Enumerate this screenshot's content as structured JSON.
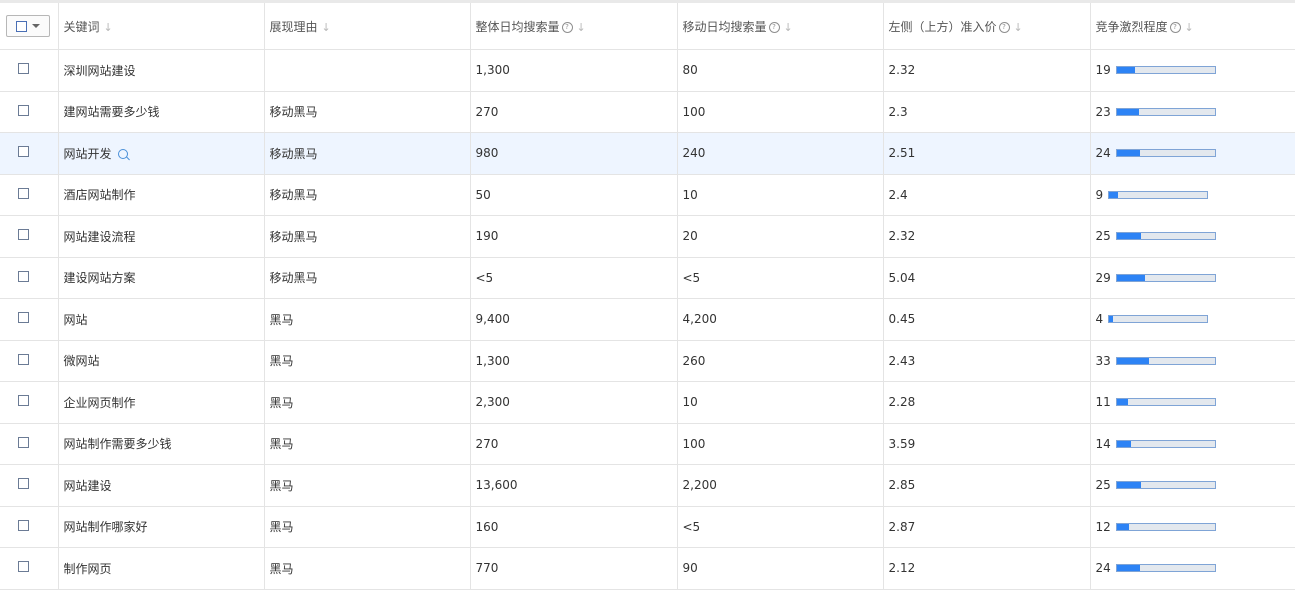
{
  "header": {
    "keyword": "关键词",
    "reason": "展现理由",
    "daily_search": "整体日均搜索量",
    "mobile_search": "移动日均搜索量",
    "left_top_price": "左侧（上方）准入价",
    "competition": "竞争激烈程度",
    "help_glyph": "?",
    "sort_glyph": "↓"
  },
  "rows": [
    {
      "keyword": "深圳网站建设",
      "reason": "",
      "daily": "1,300",
      "mobile": "80",
      "price": "2.32",
      "competition": 19,
      "has_search_icon": false
    },
    {
      "keyword": "建网站需要多少钱",
      "reason": "移动黑马",
      "daily": "270",
      "mobile": "100",
      "price": "2.3",
      "competition": 23,
      "has_search_icon": false
    },
    {
      "keyword": "网站开发",
      "reason": "移动黑马",
      "daily": "980",
      "mobile": "240",
      "price": "2.51",
      "competition": 24,
      "has_search_icon": true
    },
    {
      "keyword": "酒店网站制作",
      "reason": "移动黑马",
      "daily": "50",
      "mobile": "10",
      "price": "2.4",
      "competition": 9,
      "has_search_icon": false
    },
    {
      "keyword": "网站建设流程",
      "reason": "移动黑马",
      "daily": "190",
      "mobile": "20",
      "price": "2.32",
      "competition": 25,
      "has_search_icon": false
    },
    {
      "keyword": "建设网站方案",
      "reason": "移动黑马",
      "daily": "<5",
      "mobile": "<5",
      "price": "5.04",
      "competition": 29,
      "has_search_icon": false
    },
    {
      "keyword": "网站",
      "reason": "黑马",
      "daily": "9,400",
      "mobile": "4,200",
      "price": "0.45",
      "competition": 4,
      "has_search_icon": false
    },
    {
      "keyword": "微网站",
      "reason": "黑马",
      "daily": "1,300",
      "mobile": "260",
      "price": "2.43",
      "competition": 33,
      "has_search_icon": false
    },
    {
      "keyword": "企业网页制作",
      "reason": "黑马",
      "daily": "2,300",
      "mobile": "10",
      "price": "2.28",
      "competition": 11,
      "has_search_icon": false
    },
    {
      "keyword": "网站制作需要多少钱",
      "reason": "黑马",
      "daily": "270",
      "mobile": "100",
      "price": "3.59",
      "competition": 14,
      "has_search_icon": false
    },
    {
      "keyword": "网站建设",
      "reason": "黑马",
      "daily": "13,600",
      "mobile": "2,200",
      "price": "2.85",
      "competition": 25,
      "has_search_icon": false
    },
    {
      "keyword": "网站制作哪家好",
      "reason": "黑马",
      "daily": "160",
      "mobile": "<5",
      "price": "2.87",
      "competition": 12,
      "has_search_icon": false
    },
    {
      "keyword": "制作网页",
      "reason": "黑马",
      "daily": "770",
      "mobile": "90",
      "price": "2.12",
      "competition": 24,
      "has_search_icon": false
    }
  ],
  "highlight_row": 2,
  "colors": {
    "bar_fill": "#2d83f5",
    "bar_track": "#e3e8ee",
    "bar_border": "#7fa4d6",
    "highlight": "#eef5ff"
  }
}
